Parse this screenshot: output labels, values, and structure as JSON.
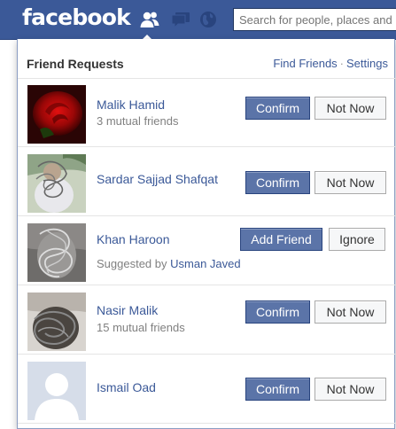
{
  "header": {
    "logo": "facebook",
    "search_placeholder": "Search for people, places and things",
    "icons": [
      "friends-icon",
      "messages-icon",
      "notifications-globe-icon"
    ],
    "brand_color": "#3b5998"
  },
  "friend_requests": {
    "title": "Friend Requests",
    "find_friends": "Find Friends",
    "separator": "·",
    "settings": "Settings",
    "items": [
      {
        "name": "Malik Hamid",
        "subtext": "3 mutual friends",
        "primary": "Confirm",
        "secondary": "Not Now",
        "avatar": "red-rose-photo"
      },
      {
        "name": "Sardar Sajjad Shafqat",
        "subtext": "",
        "primary": "Confirm",
        "secondary": "Not Now",
        "avatar": "scribbled-photo"
      },
      {
        "name": "Khan Haroon",
        "subtext_prefix": "Suggested by",
        "subtext_link": "Usman Javed",
        "primary": "Add Friend",
        "secondary": "Ignore",
        "avatar": "scribbled-photo"
      },
      {
        "name": "Nasir Malik",
        "subtext": "15 mutual friends",
        "primary": "Confirm",
        "secondary": "Not Now",
        "avatar": "scribbled-photo"
      },
      {
        "name": "Ismail Oad",
        "subtext": "",
        "primary": "Confirm",
        "secondary": "Not Now",
        "avatar": "default-silhouette"
      }
    ]
  }
}
